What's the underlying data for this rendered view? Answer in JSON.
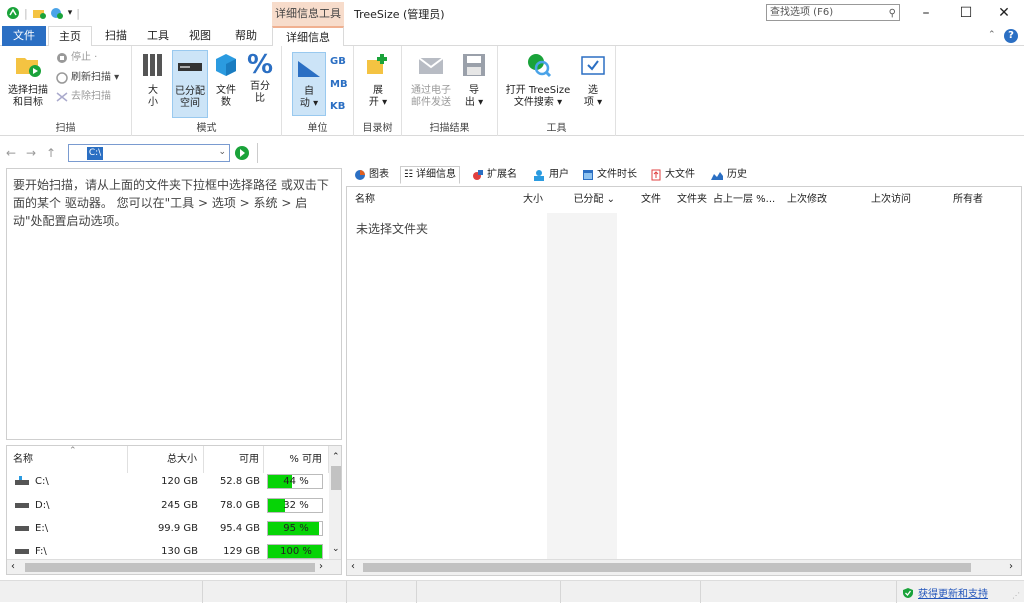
{
  "title": {
    "context_tab": "详细信息工具",
    "app": "TreeSize  (管理员)",
    "search_placeholder": "查找选项 (F6)"
  },
  "tabs": {
    "file": "文件",
    "home": "主页",
    "scan": "扫描",
    "tools": "工具",
    "view": "视图",
    "help": "帮助",
    "details": "详细信息"
  },
  "ribbon": {
    "scan": {
      "select_line1": "选择扫描",
      "select_line2": "和目标",
      "stop": "停止 ·",
      "refresh": "刷新扫描 ▾",
      "remove": "去除扫描",
      "group": "扫描"
    },
    "mode": {
      "size_l1": "大",
      "size_l2": "小",
      "alloc_l1": "已分配",
      "alloc_l2": "空间",
      "files_l1": "文件",
      "files_l2": "数",
      "pct_l1": "百分",
      "pct_l2": "比",
      "group": "模式"
    },
    "unit": {
      "auto_l1": "自",
      "auto_l2": "动 ▾",
      "gb": "GB",
      "mb": "MB",
      "kb": "KB",
      "group": "单位"
    },
    "tree": {
      "expand_l1": "展",
      "expand_l2": "开 ▾",
      "group": "目录树"
    },
    "results": {
      "email_l1": "通过电子",
      "email_l2": "邮件发送",
      "export_l1": "导",
      "export_l2": "出 ▾",
      "group": "扫描结果"
    },
    "tools": {
      "open_l1": "打开 TreeSize",
      "open_l2": "文件搜索 ▾",
      "opt_l1": "选",
      "opt_l2": "项 ▾",
      "group": "工具"
    }
  },
  "address": {
    "path": "C:\\"
  },
  "left": {
    "hint": "要开始扫描，请从上面的文件夹下拉框中选择路径 或双击下面的某个 驱动器。 您可以在\"工具 > 选项 > 系统 > 启动\"处配置启动选项。"
  },
  "drives": {
    "headers": [
      "名称",
      "总大小",
      "可用",
      "% 可用"
    ],
    "rows": [
      {
        "name": "C:\\",
        "total": "120 GB",
        "free": "52.8 GB",
        "pct": "44 %",
        "pct_value": 44
      },
      {
        "name": "D:\\",
        "total": "245 GB",
        "free": "78.0 GB",
        "pct": "32 %",
        "pct_value": 32
      },
      {
        "name": "E:\\",
        "total": "99.9 GB",
        "free": "95.4 GB",
        "pct": "95 %",
        "pct_value": 95
      },
      {
        "name": "F:\\",
        "total": "130 GB",
        "free": "129 GB",
        "pct": "100 %",
        "pct_value": 100
      }
    ]
  },
  "right": {
    "tabs": [
      "图表",
      "详细信息",
      "扩展名",
      "用户",
      "文件时长",
      "大文件",
      "历史"
    ],
    "headers": [
      "名称",
      "大小",
      "已分配 ⌄",
      "文件",
      "文件夹",
      "占上一层 %...",
      "上次修改",
      "上次访问",
      "所有者"
    ],
    "empty": "未选择文件夹"
  },
  "status": {
    "update": "获得更新和支持"
  }
}
